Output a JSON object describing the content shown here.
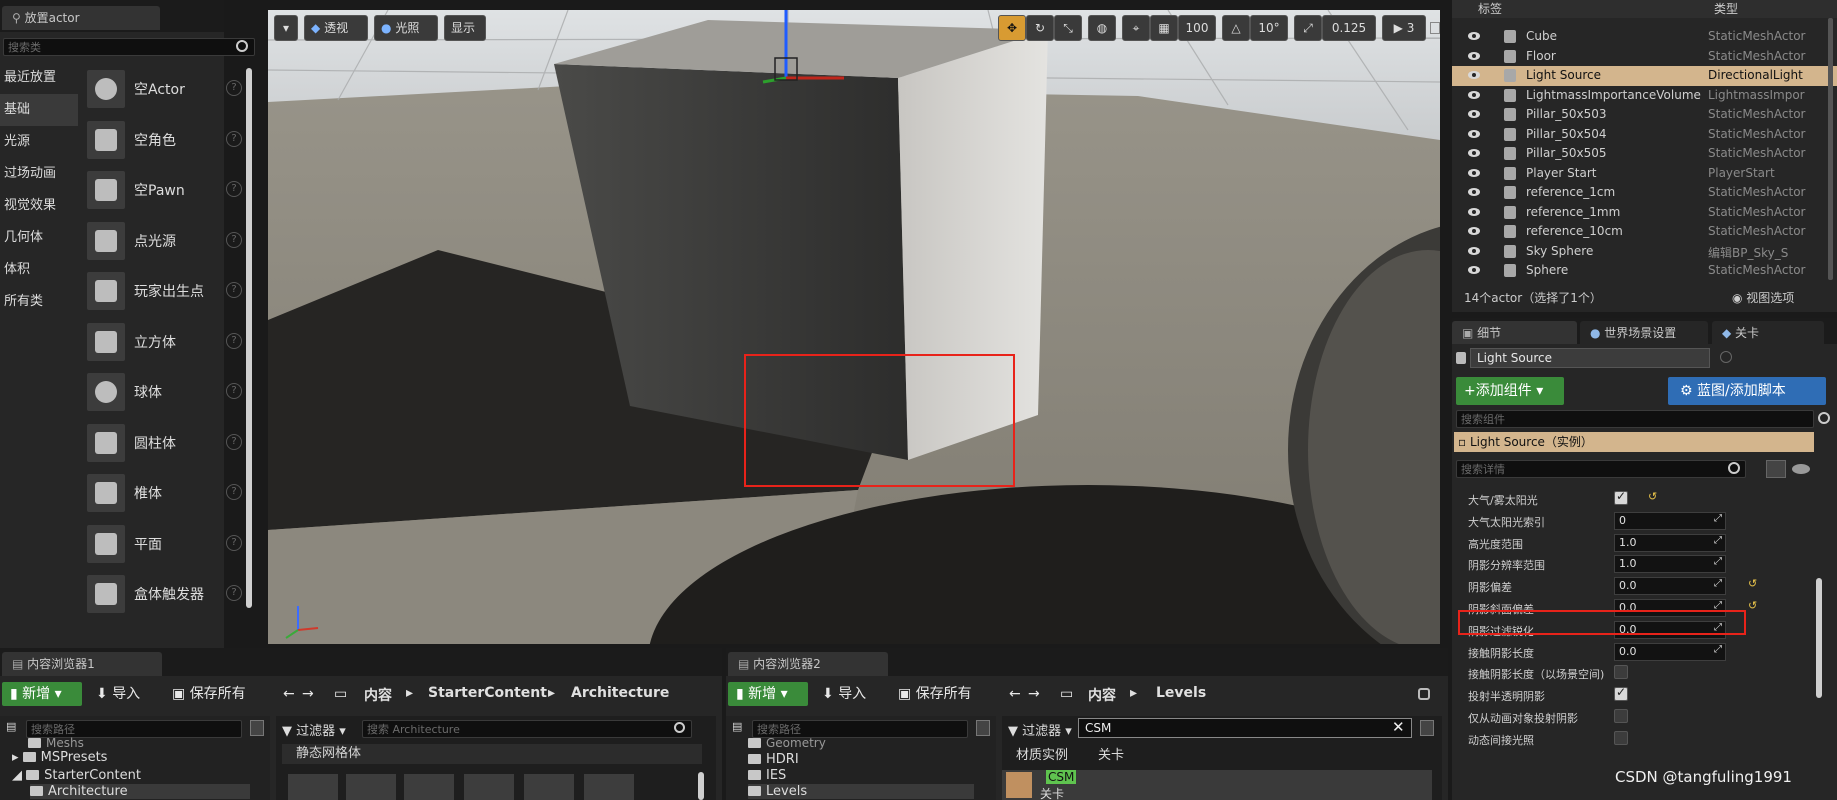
{
  "place_actors": {
    "tab_title": "放置actor",
    "search_placeholder": "搜索类",
    "categories": [
      "最近放置",
      "基础",
      "光源",
      "过场动画",
      "视觉效果",
      "几何体",
      "体积",
      "所有类"
    ],
    "items": [
      "空Actor",
      "空角色",
      "空Pawn",
      "点光源",
      "玩家出生点",
      "立方体",
      "球体",
      "圆柱体",
      "椎体",
      "平面",
      "盒体触发器"
    ]
  },
  "viewport": {
    "view_mode": "透视",
    "lighting": "光照",
    "show": "显示",
    "grid_snap": "100",
    "rotation_snap": "10°",
    "scale_snap": "0.125",
    "camera_speed": "3"
  },
  "outliner": {
    "col_label": "标签",
    "col_type": "类型",
    "rows": [
      {
        "name": "Cube",
        "type": "StaticMeshActor"
      },
      {
        "name": "Floor",
        "type": "StaticMeshActor"
      },
      {
        "name": "Light Source",
        "type": "DirectionalLight"
      },
      {
        "name": "LightmassImportanceVolume",
        "type": "LightmassImpor"
      },
      {
        "name": "Pillar_50x503",
        "type": "StaticMeshActor"
      },
      {
        "name": "Pillar_50x504",
        "type": "StaticMeshActor"
      },
      {
        "name": "Pillar_50x505",
        "type": "StaticMeshActor"
      },
      {
        "name": "Player Start",
        "type": "PlayerStart"
      },
      {
        "name": "reference_1cm",
        "type": "StaticMeshActor"
      },
      {
        "name": "reference_1mm",
        "type": "StaticMeshActor"
      },
      {
        "name": "reference_10cm",
        "type": "StaticMeshActor"
      },
      {
        "name": "Sky Sphere",
        "type": "编辑BP_Sky_S"
      },
      {
        "name": "Sphere",
        "type": "StaticMeshActor"
      }
    ],
    "footer": "14个actor（选择了1个）",
    "view_options": "视图选项"
  },
  "details": {
    "tabs": [
      "细节",
      "世界场景设置",
      "关卡"
    ],
    "actor_name": "Light Source",
    "add_component": "+添加组件",
    "blueprint": "蓝图/添加脚本",
    "search_components": "搜索组件",
    "instance": "Light Source（实例）",
    "search_details": "搜索详情",
    "props": [
      {
        "label": "大气/雾太阳光",
        "kind": "check",
        "value": true
      },
      {
        "label": "大气太阳光索引",
        "kind": "num",
        "value": "0"
      },
      {
        "label": "高光度范围",
        "kind": "num",
        "value": "1.0"
      },
      {
        "label": "阴影分辨率范围",
        "kind": "num",
        "value": "1.0"
      },
      {
        "label": "阴影偏差",
        "kind": "num",
        "value": "0.0"
      },
      {
        "label": "阴影斜面偏差",
        "kind": "num",
        "value": "0.0"
      },
      {
        "label": "阴影过滤锐化",
        "kind": "num",
        "value": "0.0"
      },
      {
        "label": "接触阴影长度",
        "kind": "num",
        "value": "0.0"
      },
      {
        "label": "接触阴影长度（以场景空间)",
        "kind": "check",
        "value": false
      },
      {
        "label": "投射半透明阴影",
        "kind": "check",
        "value": true
      },
      {
        "label": "仅从动画对象投射阴影",
        "kind": "check",
        "value": false
      },
      {
        "label": "动态间接光照",
        "kind": "check",
        "value": false
      }
    ]
  },
  "content_browser_1": {
    "tab": "内容浏览器1",
    "new": "新增",
    "import": "导入",
    "save_all": "保存所有",
    "path": [
      "内容",
      "StarterContent",
      "Architecture"
    ],
    "search_paths": "搜索路径",
    "filters": "过滤器",
    "search_assets": "搜索 Architecture",
    "tree": [
      "Meshs",
      "MSPresets",
      "StarterContent",
      "Architecture"
    ],
    "category": "静态网格体"
  },
  "content_browser_2": {
    "tab": "内容浏览器2",
    "new": "新增",
    "import": "导入",
    "save_all": "保存所有",
    "path": [
      "内容",
      "Levels"
    ],
    "search_paths": "搜索路径",
    "filters": "过滤器",
    "search_value": "CSM",
    "tree": [
      "Geometry",
      "HDRI",
      "IES",
      "Levels"
    ],
    "asset_tabs": [
      "材质实例",
      "关卡"
    ],
    "asset_name": "CSM",
    "asset_type": "关卡"
  },
  "watermark": "CSDN @tangfuling1991",
  "colors": {
    "highlight_box": "#e8231a",
    "selection": "#d3b58d",
    "accent_blue": "#2f6db5",
    "accent_green": "#3a8b3a"
  }
}
